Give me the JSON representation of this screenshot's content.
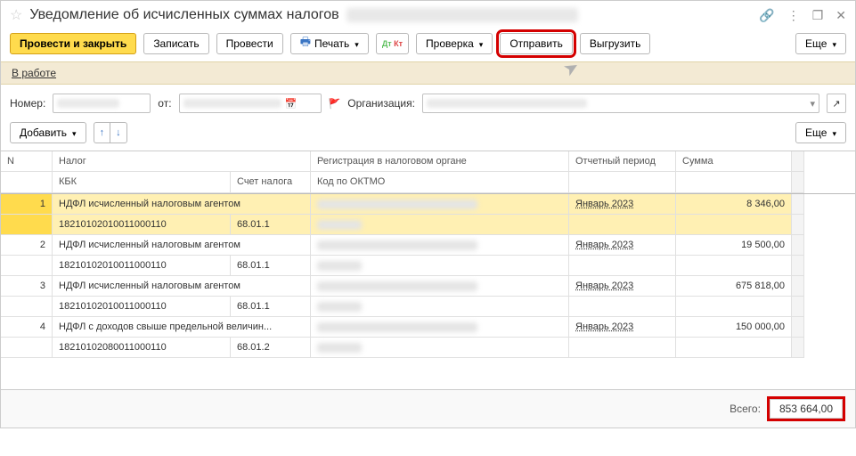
{
  "title": "Уведомление об исчисленных суммах налогов",
  "toolbar": {
    "post_and_close": "Провести и закрыть",
    "save": "Записать",
    "post": "Провести",
    "print": "Печать",
    "check": "Проверка",
    "send": "Отправить",
    "export": "Выгрузить",
    "more": "Еще"
  },
  "status": {
    "label": "В работе"
  },
  "filters": {
    "number_label": "Номер:",
    "from_label": "от:",
    "org_label": "Организация:"
  },
  "tabletb": {
    "add": "Добавить",
    "more": "Еще"
  },
  "grid": {
    "head": {
      "n": "N",
      "tax": "Налог",
      "reg": "Регистрация в налоговом органе",
      "period": "Отчетный период",
      "sum": "Сумма",
      "kbk": "КБК",
      "acct": "Счет налога",
      "oktmo": "Код по ОКТМО"
    },
    "rows": [
      {
        "n": "1",
        "tax": "НДФЛ исчисленный налоговым агентом",
        "kbk": "18210102010011000110",
        "acct": "68.01.1",
        "period": "Январь 2023",
        "sum": "8 346,00"
      },
      {
        "n": "2",
        "tax": "НДФЛ исчисленный налоговым агентом",
        "kbk": "18210102010011000110",
        "acct": "68.01.1",
        "period": "Январь 2023",
        "sum": "19 500,00"
      },
      {
        "n": "3",
        "tax": "НДФЛ исчисленный налоговым агентом",
        "kbk": "18210102010011000110",
        "acct": "68.01.1",
        "period": "Январь 2023",
        "sum": "675 818,00"
      },
      {
        "n": "4",
        "tax": "НДФЛ с доходов свыше предельной величин...",
        "kbk": "18210102080011000110",
        "acct": "68.01.2",
        "period": "Январь 2023",
        "sum": "150 000,00"
      }
    ]
  },
  "footer": {
    "total_label": "Всего:",
    "total_value": "853 664,00"
  }
}
